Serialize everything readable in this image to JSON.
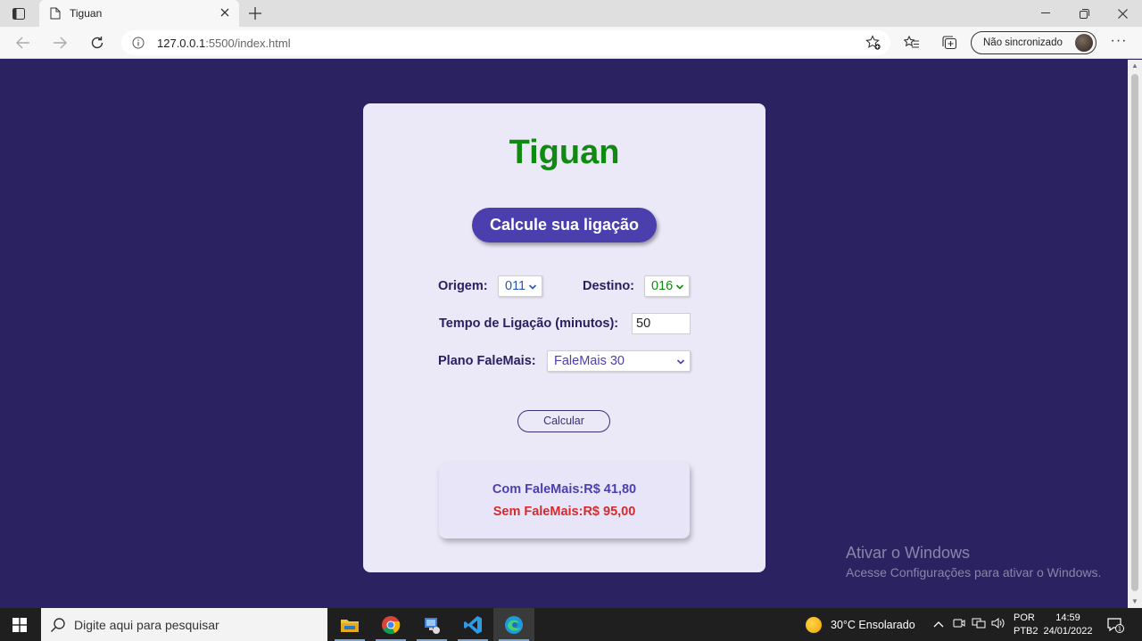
{
  "browser": {
    "tab_title": "Tiguan",
    "url_host": "127.0.0.1",
    "url_rest": ":5500/index.html",
    "sync_label": "Não sincronizado",
    "more_label": "···"
  },
  "page": {
    "title": "Tiguan",
    "hero_button": "Calcule sua ligação",
    "origem_label": "Origem:",
    "origem_value": "011",
    "destino_label": "Destino:",
    "destino_value": "016",
    "tempo_label": "Tempo de Ligação (minutos):",
    "tempo_value": "50",
    "plano_label": "Plano FaleMais:",
    "plano_value": "FaleMais 30",
    "calc_button": "Calcular",
    "com_falemais": "Com FaleMais:R$ 41,80",
    "sem_falemais": "Sem FaleMais:R$ 95,00",
    "colors": {
      "background": "#2a2261",
      "card": "#ebe8f8",
      "title_green": "#118a11",
      "accent": "#4b3fae",
      "red": "#d62b2b"
    }
  },
  "watermark": {
    "line1": "Ativar o Windows",
    "line2": "Acesse Configurações para ativar o Windows."
  },
  "taskbar": {
    "search_placeholder": "Digite aqui para pesquisar",
    "weather": "30°C  Ensolarado",
    "lang_line1": "POR",
    "lang_line2": "PTB2",
    "time": "14:59",
    "date": "24/01/2022",
    "notif_count": "1",
    "apps": [
      "file-explorer",
      "chrome",
      "network-app",
      "vscode",
      "edge"
    ]
  }
}
